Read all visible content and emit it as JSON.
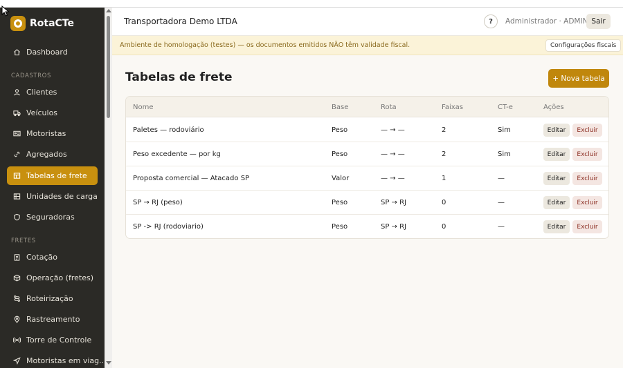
{
  "brand": {
    "name": "RotaCTe",
    "accent": "#c8900f"
  },
  "header": {
    "company": "Transportadora Demo LTDA",
    "help_label": "?",
    "user": "Administrador · ADMIN",
    "logout_label": "Sair"
  },
  "banner": {
    "text": "Ambiente de homologação (testes) — os documentos emitidos NÃO têm validade fiscal.",
    "button_label": "Configurações fiscais"
  },
  "sidebar": {
    "dashboard": {
      "label": "Dashboard",
      "icon": "home-icon"
    },
    "sections": [
      "CADASTROS",
      "FRETES"
    ],
    "cadastros": [
      {
        "label": "Clientes",
        "icon": "user-icon"
      },
      {
        "label": "Veículos",
        "icon": "truck-icon"
      },
      {
        "label": "Motoristas",
        "icon": "id-card-icon"
      },
      {
        "label": "Agregados",
        "icon": "link-icon"
      },
      {
        "label": "Tabelas de frete",
        "icon": "table-icon",
        "active": true
      },
      {
        "label": "Unidades de carga",
        "icon": "container-icon"
      },
      {
        "label": "Seguradoras",
        "icon": "shield-icon"
      }
    ],
    "fretes": [
      {
        "label": "Cotação",
        "icon": "clipboard-icon"
      },
      {
        "label": "Operação (fretes)",
        "icon": "box-icon"
      },
      {
        "label": "Roteirização",
        "icon": "route-icon"
      },
      {
        "label": "Rastreamento",
        "icon": "map-pin-icon"
      },
      {
        "label": "Torre de Controle",
        "icon": "broadcast-icon"
      },
      {
        "label": "Motoristas em viag...",
        "icon": "navigation-icon"
      }
    ]
  },
  "main": {
    "title": "Tabelas de frete",
    "new_button": "+ Nova tabela",
    "columns": [
      "Nome",
      "Base",
      "Rota",
      "Faixas",
      "CT-e",
      "Ações"
    ],
    "rows": [
      {
        "nome": "Paletes — rodoviário",
        "base": "Peso",
        "rota": "— → —",
        "faixas": "2",
        "cte": "Sim"
      },
      {
        "nome": "Peso excedente — por kg",
        "base": "Peso",
        "rota": "— → —",
        "faixas": "2",
        "cte": "Sim"
      },
      {
        "nome": "Proposta comercial — Atacado SP",
        "base": "Valor",
        "rota": "— → —",
        "faixas": "1",
        "cte": "—"
      },
      {
        "nome": "SP → RJ (peso)",
        "base": "Peso",
        "rota": "SP → RJ",
        "faixas": "0",
        "cte": "—"
      },
      {
        "nome": "SP -> RJ (rodoviario)",
        "base": "Peso",
        "rota": "SP → RJ",
        "faixas": "0",
        "cte": "—"
      }
    ],
    "edit_label": "Editar",
    "delete_label": "Excluir"
  }
}
